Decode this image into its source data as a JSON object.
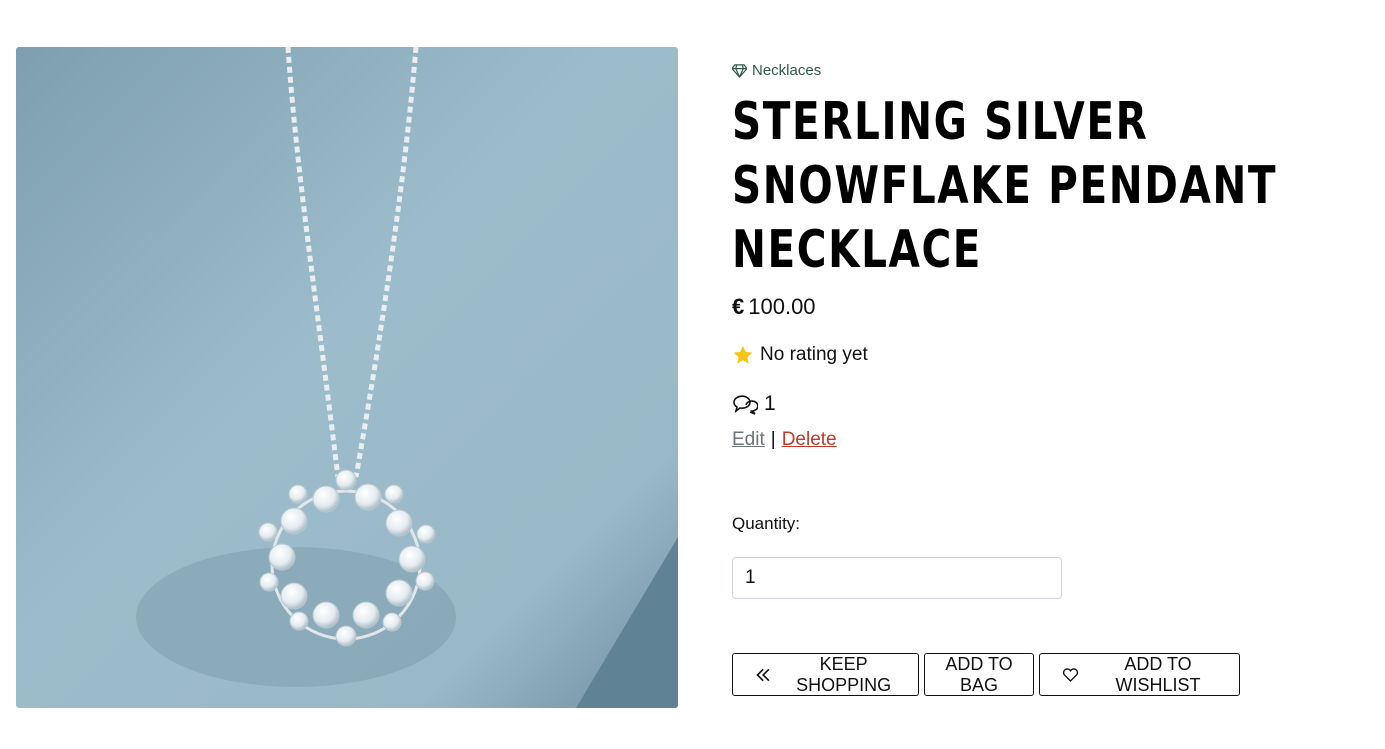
{
  "product": {
    "category": "Necklaces",
    "category_icon": "gem-icon",
    "title": "Sterling Silver Snowflake Pendant Necklace",
    "currency": "€",
    "price": "100.00",
    "rating_text": "No rating yet",
    "rating_icon": "star-icon",
    "comment_count": "1",
    "comment_icon": "comments-icon",
    "image_alt": "Sterling Silver Snowflake Pendant Necklace"
  },
  "admin": {
    "edit_label": "Edit",
    "separator": "|",
    "delete_label": "Delete"
  },
  "quantity": {
    "label": "Quantity:",
    "value": "1"
  },
  "buttons": {
    "keep_shopping": "Keep Shopping",
    "add_to_bag": "Add to Bag",
    "add_to_wishlist": "Add to Wishlist"
  },
  "colors": {
    "category": "#2d5a4c",
    "delete": "#c0392b",
    "edit": "#6c757d",
    "star": "#f5c518",
    "image_bg": "#8fb1c2"
  }
}
